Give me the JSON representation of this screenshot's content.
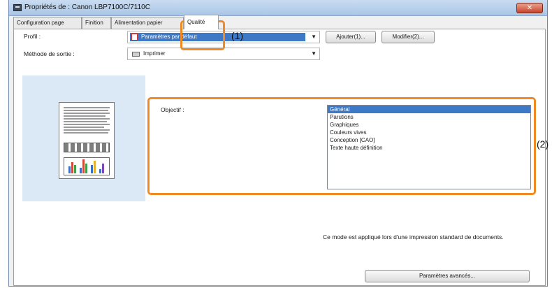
{
  "window": {
    "title": "Propriétés de : Canon LBP7100C/7110C",
    "close_glyph": "✕"
  },
  "tabs": [
    {
      "label": "Configuration page"
    },
    {
      "label": "Finition"
    },
    {
      "label": "Alimentation papier"
    },
    {
      "label": "Qualité"
    }
  ],
  "profile": {
    "label": "Profil :",
    "value": "Paramètres par défaut",
    "add_button": "Ajouter(1)...",
    "edit_button": "Modifier(2)..."
  },
  "output": {
    "label": "Méthode de sortie :",
    "value": "Imprimer"
  },
  "objective": {
    "label": "Objectif :",
    "items": [
      "Général",
      "Parutions",
      "Graphiques",
      "Couleurs vives",
      "Conception [CAO]",
      "Texte haute définition"
    ],
    "selected_index": 0
  },
  "description": "Ce mode est appliqué lors d'une impression standard de documents.",
  "advanced_button": "Paramètres avancés...",
  "annotations": {
    "callout_1": "(1)",
    "callout_2": "(2)"
  },
  "colors": {
    "accent": "#ef8a25",
    "selection": "#3d79c6",
    "preview_bg": "#dbe9f6"
  }
}
